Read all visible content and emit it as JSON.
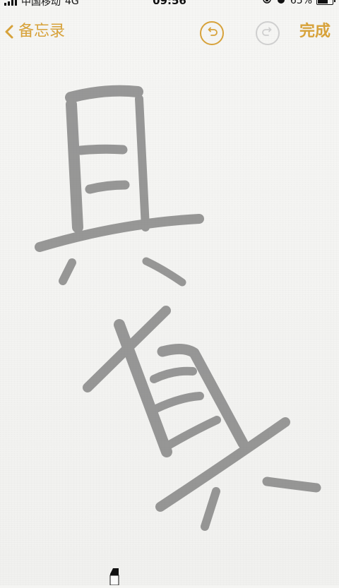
{
  "status": {
    "carrier": "中国移动",
    "network": "4G",
    "time": "09:56",
    "battery": "65%"
  },
  "nav": {
    "back_label": "备忘录",
    "done_label": "完成",
    "back_icon": "chevron-left-icon",
    "undo_icon": "undo-icon",
    "redo_icon": "redo-icon"
  },
  "drawing": {
    "description_color": "#6a6a6a"
  },
  "colors": {
    "accent": "#d7a23a",
    "redo_disabled": "#cfcfcf"
  }
}
